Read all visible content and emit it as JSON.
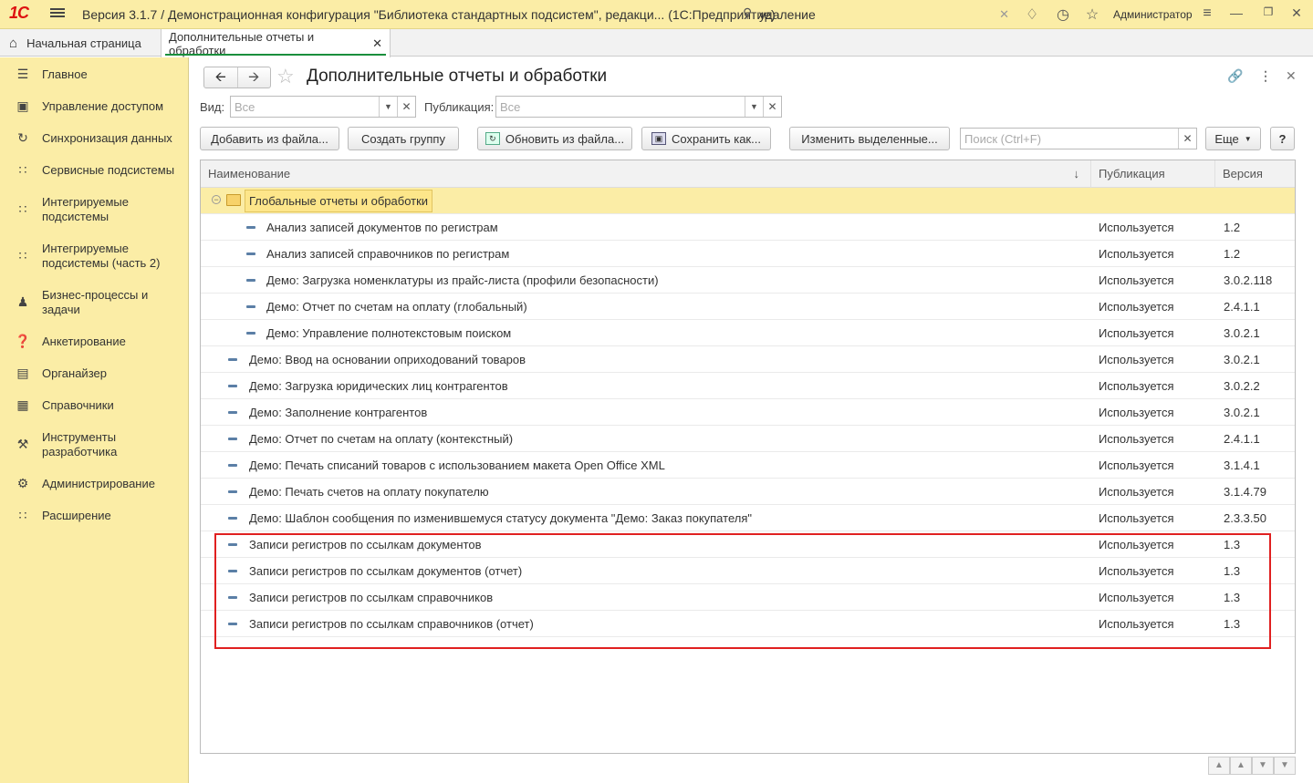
{
  "window": {
    "logo": "1С",
    "title": "Версия 3.1.7 / Демонстрационная конфигурация \"Библиотека стандартных подсистем\", редакци... (1С:Предприятие)",
    "search_value": "удаление",
    "user": "Администратор"
  },
  "tabs": [
    {
      "label": "Начальная страница"
    },
    {
      "label": "Дополнительные отчеты и обработки"
    }
  ],
  "sidebar": [
    {
      "label": "Главное",
      "icon": "menu-icon"
    },
    {
      "label": "Управление доступом",
      "icon": "lock-icon"
    },
    {
      "label": "Синхронизация данных",
      "icon": "sync-icon"
    },
    {
      "label": "Сервисные подсистемы",
      "icon": "grid-icon"
    },
    {
      "label": "Интегрируемые подсистемы",
      "icon": "grid-icon"
    },
    {
      "label": "Интегрируемые подсистемы (часть 2)",
      "icon": "grid-icon"
    },
    {
      "label": "Бизнес-процессы и задачи",
      "icon": "users-icon"
    },
    {
      "label": "Анкетирование",
      "icon": "question-icon"
    },
    {
      "label": "Органайзер",
      "icon": "notepad-icon"
    },
    {
      "label": "Справочники",
      "icon": "book-icon"
    },
    {
      "label": "Инструменты разработчика",
      "icon": "wrench-icon"
    },
    {
      "label": "Администрирование",
      "icon": "gear-icon"
    },
    {
      "label": "Расширение",
      "icon": "grid-icon"
    }
  ],
  "form": {
    "title": "Дополнительные отчеты и обработки",
    "filter_view_label": "Вид:",
    "filter_view_placeholder": "Все",
    "filter_pub_label": "Публикация:",
    "filter_pub_placeholder": "Все",
    "buttons": {
      "add_from_file": "Добавить из файла...",
      "create_group": "Создать группу",
      "update_from_file": "Обновить из файла...",
      "save_as": "Сохранить как...",
      "change_selected": "Изменить выделенные...",
      "more": "Еще",
      "help": "?"
    },
    "search_placeholder": "Поиск (Ctrl+F)"
  },
  "table": {
    "columns": [
      "Наименование",
      "Публикация",
      "Версия"
    ],
    "group": "Глобальные отчеты и обработки",
    "rows": [
      {
        "name": "Анализ записей документов по регистрам",
        "pub": "Используется",
        "ver": "1.2",
        "level": 2
      },
      {
        "name": "Анализ записей справочников по регистрам",
        "pub": "Используется",
        "ver": "1.2",
        "level": 2
      },
      {
        "name": "Демо: Загрузка номенклатуры из прайс-листа (профили безопасности)",
        "pub": "Используется",
        "ver": "3.0.2.118",
        "level": 2
      },
      {
        "name": "Демо: Отчет по счетам на оплату (глобальный)",
        "pub": "Используется",
        "ver": "2.4.1.1",
        "level": 2
      },
      {
        "name": "Демо: Управление полнотекстовым поиском",
        "pub": "Используется",
        "ver": "3.0.2.1",
        "level": 2
      },
      {
        "name": "Демо: Ввод на основании оприходований товаров",
        "pub": "Используется",
        "ver": "3.0.2.1",
        "level": 1
      },
      {
        "name": "Демо: Загрузка юридических лиц контрагентов",
        "pub": "Используется",
        "ver": "3.0.2.2",
        "level": 1
      },
      {
        "name": "Демо: Заполнение контрагентов",
        "pub": "Используется",
        "ver": "3.0.2.1",
        "level": 1
      },
      {
        "name": "Демо: Отчет по счетам на оплату (контекстный)",
        "pub": "Используется",
        "ver": "2.4.1.1",
        "level": 1
      },
      {
        "name": "Демо: Печать списаний товаров с использованием макета Open Office XML",
        "pub": "Используется",
        "ver": "3.1.4.1",
        "level": 1
      },
      {
        "name": "Демо: Печать счетов на оплату покупателю",
        "pub": "Используется",
        "ver": "3.1.4.79",
        "level": 1
      },
      {
        "name": "Демо: Шаблон сообщения по изменившемуся статусу документа \"Демо: Заказ покупателя\"",
        "pub": "Используется",
        "ver": "2.3.3.50",
        "level": 1
      },
      {
        "name": "Записи регистров по ссылкам документов",
        "pub": "Используется",
        "ver": "1.3",
        "level": 1
      },
      {
        "name": "Записи регистров по ссылкам документов (отчет)",
        "pub": "Используется",
        "ver": "1.3",
        "level": 1
      },
      {
        "name": "Записи регистров по ссылкам справочников",
        "pub": "Используется",
        "ver": "1.3",
        "level": 1
      },
      {
        "name": "Записи регистров по ссылкам справочников (отчет)",
        "pub": "Используется",
        "ver": "1.3",
        "level": 1
      }
    ]
  },
  "colors": {
    "highlight": "#e02020",
    "sidebar_bg": "#fbeda6",
    "row_mark": "#5b7fa6"
  }
}
